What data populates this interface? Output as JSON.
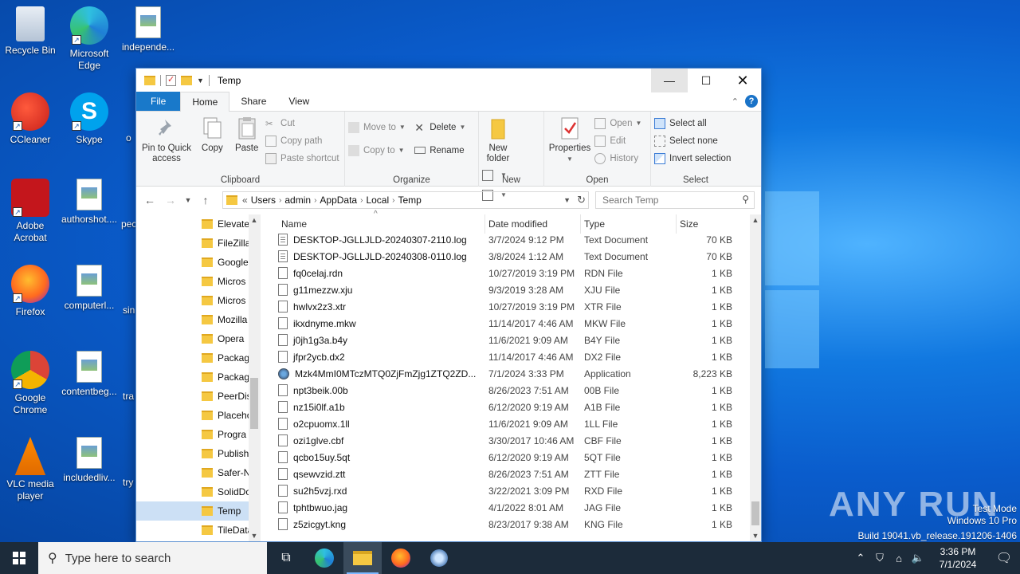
{
  "desktop": {
    "icons": [
      {
        "name": "recycle-bin",
        "label": "Recycle Bin"
      },
      {
        "name": "microsoft-edge",
        "label": "Microsoft Edge"
      },
      {
        "name": "independent-file",
        "label": "independe..."
      },
      {
        "name": "ccleaner",
        "label": "CCleaner"
      },
      {
        "name": "skype",
        "label": "Skype"
      },
      {
        "name": "adobe-acrobat",
        "label": "Adobe Acrobat"
      },
      {
        "name": "authorshot-file",
        "label": "authorshot...."
      },
      {
        "name": "firefox",
        "label": "Firefox"
      },
      {
        "name": "computerl-file",
        "label": "computerl..."
      },
      {
        "name": "google-chrome",
        "label": "Google Chrome"
      },
      {
        "name": "contentbeg-file",
        "label": "contentbeg..."
      },
      {
        "name": "vlc",
        "label": "VLC media player"
      },
      {
        "name": "includedliv-file",
        "label": "includedliv..."
      }
    ],
    "partial_labels": [
      "o",
      "pec",
      "sin",
      "tra",
      "try"
    ],
    "watermark": "ANY RUN",
    "test_mode": {
      "line1": "Test Mode",
      "line2": "Windows 10 Pro",
      "line3": "Build 19041.vb_release.191206-1406"
    }
  },
  "window": {
    "title": "Temp",
    "controls": {
      "minimize": "—",
      "maximize": "☐",
      "close": "✕"
    },
    "tabs": [
      "File",
      "Home",
      "Share",
      "View"
    ],
    "active_tab": "Home",
    "ribbon": {
      "clipboard": {
        "label": "Clipboard",
        "pin": "Pin to Quick access",
        "copy": "Copy",
        "paste": "Paste",
        "cut": "Cut",
        "copy_path": "Copy path",
        "paste_shortcut": "Paste shortcut"
      },
      "organize": {
        "label": "Organize",
        "move_to": "Move to",
        "copy_to": "Copy to",
        "delete": "Delete",
        "rename": "Rename"
      },
      "new": {
        "label": "New",
        "new_folder": "New folder"
      },
      "open": {
        "label": "Open",
        "properties": "Properties",
        "open": "Open",
        "edit": "Edit",
        "history": "History"
      },
      "select": {
        "label": "Select",
        "select_all": "Select all",
        "select_none": "Select none",
        "invert": "Invert selection"
      }
    },
    "address": {
      "prefix": "«",
      "crumbs": [
        "Users",
        "admin",
        "AppData",
        "Local",
        "Temp"
      ],
      "search_placeholder": "Search Temp"
    },
    "nav_items": [
      "Elevate",
      "FileZilla",
      "Google",
      "Micros",
      "Micros",
      "Mozilla",
      "Opera",
      "Packag",
      "Packag",
      "PeerDis",
      "Placeho",
      "Progra",
      "Publish",
      "Safer-N",
      "SolidDo",
      "Temp",
      "TileData"
    ],
    "nav_selected": 15,
    "columns": {
      "name": "Name",
      "date": "Date modified",
      "type": "Type",
      "size": "Size"
    },
    "files": [
      {
        "name": "DESKTOP-JGLLJLD-20240307-2110.log",
        "date": "3/7/2024 9:12 PM",
        "type": "Text Document",
        "size": "70 KB",
        "icon": "txt"
      },
      {
        "name": "DESKTOP-JGLLJLD-20240308-0110.log",
        "date": "3/8/2024 1:12 AM",
        "type": "Text Document",
        "size": "70 KB",
        "icon": "txt"
      },
      {
        "name": "fq0celaj.rdn",
        "date": "10/27/2019 3:19 PM",
        "type": "RDN File",
        "size": "1 KB",
        "icon": "blank"
      },
      {
        "name": "g11mezzw.xju",
        "date": "9/3/2019 3:28 AM",
        "type": "XJU File",
        "size": "1 KB",
        "icon": "blank"
      },
      {
        "name": "hwlvx2z3.xtr",
        "date": "10/27/2019 3:19 PM",
        "type": "XTR File",
        "size": "1 KB",
        "icon": "blank"
      },
      {
        "name": "ikxdnyme.mkw",
        "date": "11/14/2017 4:46 AM",
        "type": "MKW File",
        "size": "1 KB",
        "icon": "blank"
      },
      {
        "name": "j0jh1g3a.b4y",
        "date": "11/6/2021 9:09 AM",
        "type": "B4Y File",
        "size": "1 KB",
        "icon": "blank"
      },
      {
        "name": "jfpr2ycb.dx2",
        "date": "11/14/2017 4:46 AM",
        "type": "DX2 File",
        "size": "1 KB",
        "icon": "blank"
      },
      {
        "name": "Mzk4MmI0MTczMTQ0ZjFmZjg1ZTQ2ZD...",
        "date": "7/1/2024 3:33 PM",
        "type": "Application",
        "size": "8,223 KB",
        "icon": "app"
      },
      {
        "name": "npt3beik.00b",
        "date": "8/26/2023 7:51 AM",
        "type": "00B File",
        "size": "1 KB",
        "icon": "blank"
      },
      {
        "name": "nz15i0lf.a1b",
        "date": "6/12/2020 9:19 AM",
        "type": "A1B File",
        "size": "1 KB",
        "icon": "blank"
      },
      {
        "name": "o2cpuomx.1ll",
        "date": "11/6/2021 9:09 AM",
        "type": "1LL File",
        "size": "1 KB",
        "icon": "blank"
      },
      {
        "name": "ozi1glve.cbf",
        "date": "3/30/2017 10:46 AM",
        "type": "CBF File",
        "size": "1 KB",
        "icon": "blank"
      },
      {
        "name": "qcbo15uy.5qt",
        "date": "6/12/2020 9:19 AM",
        "type": "5QT File",
        "size": "1 KB",
        "icon": "blank"
      },
      {
        "name": "qsewvzid.ztt",
        "date": "8/26/2023 7:51 AM",
        "type": "ZTT File",
        "size": "1 KB",
        "icon": "blank"
      },
      {
        "name": "su2h5vzj.rxd",
        "date": "3/22/2021 3:09 PM",
        "type": "RXD File",
        "size": "1 KB",
        "icon": "blank"
      },
      {
        "name": "tphtbwuo.jag",
        "date": "4/1/2022 8:01 AM",
        "type": "JAG File",
        "size": "1 KB",
        "icon": "blank"
      },
      {
        "name": "z5zicgyt.kng",
        "date": "8/23/2017 9:38 AM",
        "type": "KNG File",
        "size": "1 KB",
        "icon": "blank"
      }
    ]
  },
  "taskbar": {
    "search_placeholder": "Type here to search",
    "apps": [
      "task-view",
      "edge",
      "file-explorer",
      "firefox",
      "app-installer"
    ],
    "time": "3:36 PM",
    "date": "7/1/2024"
  },
  "colors": {
    "accent": "#1979ca",
    "selection": "#cce0f5",
    "taskbar": "#1c2b3a"
  }
}
